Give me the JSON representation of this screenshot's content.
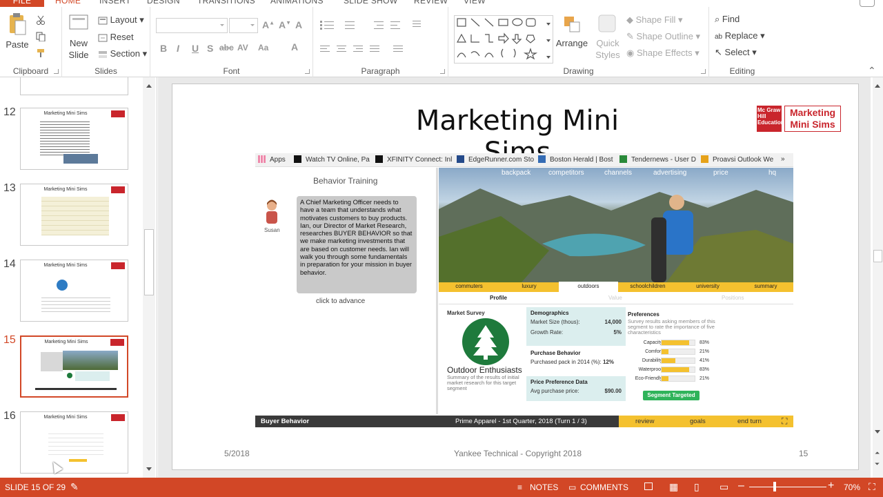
{
  "ribbon_tabs": [
    "FILE",
    "HOME",
    "INSERT",
    "DESIGN",
    "TRANSITIONS",
    "ANIMATIONS",
    "SLIDE SHOW",
    "REVIEW",
    "VIEW"
  ],
  "clipboard": {
    "paste": "Paste",
    "label": "Clipboard"
  },
  "slides": {
    "new_slide_1": "New",
    "new_slide_2": "Slide",
    "layout": "Layout",
    "reset": "Reset",
    "section": "Section",
    "label": "Slides"
  },
  "font": {
    "label": "Font"
  },
  "paragraph": {
    "label": "Paragraph"
  },
  "drawing": {
    "arrange": "Arrange",
    "quick_styles_1": "Quick",
    "quick_styles_2": "Styles",
    "shape_fill": "Shape Fill",
    "shape_outline": "Shape Outline",
    "shape_effects": "Shape Effects",
    "label": "Drawing"
  },
  "editing": {
    "find": "Find",
    "replace": "Replace",
    "select": "Select",
    "label": "Editing"
  },
  "thumbnails": [
    {
      "num": "12",
      "title": "Marketing Mini Sims"
    },
    {
      "num": "13",
      "title": "Marketing Mini Sims"
    },
    {
      "num": "14",
      "title": "Marketing Mini Sims"
    },
    {
      "num": "15",
      "title": "Marketing Mini Sims"
    },
    {
      "num": "16",
      "title": "Marketing Mini Sims"
    }
  ],
  "slide": {
    "title": "Marketing Mini Sims",
    "logo_left": "Mc Graw Hill Education",
    "logo_right_1": "Marketing",
    "logo_right_2": "Mini Sims",
    "footer_date": "5/2018",
    "footer_center": "Yankee Technical - Copyright 2018",
    "footer_page": "15"
  },
  "bookmarks": [
    "Apps",
    "Watch TV Online, Pa",
    "XFINITY Connect: Inl",
    "EdgeRunner.com Sto",
    "Boston Herald | Bost",
    "Tendernews - User D",
    "Proavsi Outlook We",
    "»"
  ],
  "sim": {
    "behavior_title": "Behavior Training",
    "bubble": "A Chief Marketing Officer needs to have a team that understands what motivates customers to buy products. Ian, our Director of Market Research, researches BUYER BEHAVIOR so that we make marketing investments that are based on customer needs. Ian will walk you through some fundamentals in preparation for your mission in buyer behavior.",
    "avatar_name": "Susan",
    "click_advance": "click to advance",
    "nav": [
      "backpack",
      "competitors",
      "channels",
      "advertising",
      "price",
      "hq"
    ],
    "segments": [
      "commuters",
      "luxury",
      "outdoors",
      "schoolchildren",
      "university",
      "summary"
    ],
    "subtabs": [
      "Profile",
      "Value",
      "Positions"
    ],
    "market_survey": "Market Survey",
    "segment_name": "Outdoor Enthusiasts",
    "segment_desc": "Summary of the results of initial market research for this target segment",
    "demographics": {
      "title": "Demographics",
      "size_label": "Market Size (thous):",
      "size": "14,000",
      "growth_label": "Growth Rate:",
      "growth": "5%"
    },
    "purchase": {
      "title": "Purchase Behavior",
      "label": "Purchased pack in 2014 (%):",
      "value": "12%"
    },
    "price": {
      "title": "Price Preference Data",
      "label": "Avg purchase price:",
      "value": "$90.00"
    },
    "preferences": {
      "title": "Preferences",
      "desc": "Survey results asking members of this segment to rate the importance of five characteristics",
      "items": [
        {
          "name": "Capacity",
          "pct": "83%",
          "value": 0.83
        },
        {
          "name": "Comfort",
          "pct": "21%",
          "value": 0.21
        },
        {
          "name": "Durability",
          "pct": "41%",
          "value": 0.41
        },
        {
          "name": "Waterproof",
          "pct": "83%",
          "value": 0.83
        },
        {
          "name": "Eco-Friendly",
          "pct": "21%",
          "value": 0.21
        }
      ]
    },
    "segment_targeted": "Segment Targeted",
    "bottom_left": "Buyer Behavior",
    "bottom_center": "Prime Apparel - 1st Quarter, 2018 (Turn 1 / 3)",
    "bottom_btns": [
      "review",
      "goals",
      "end turn"
    ]
  },
  "status": {
    "slide": "SLIDE 15 OF 29",
    "notes": "NOTES",
    "comments": "COMMENTS",
    "zoom": "70%"
  }
}
